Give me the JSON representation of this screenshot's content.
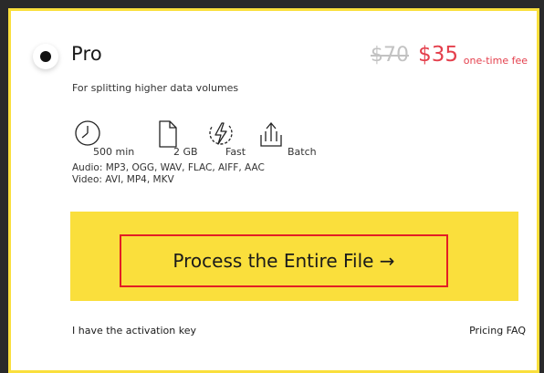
{
  "plan": {
    "name": "Pro",
    "old_price": "$70",
    "new_price": "$35",
    "fee_note": "one-time fee",
    "description": "For splitting higher data volumes"
  },
  "features": [
    {
      "icon": "clock-icon",
      "label": "500 min"
    },
    {
      "icon": "file-icon",
      "label": "2 GB"
    },
    {
      "icon": "lightning-icon",
      "label": "Fast"
    },
    {
      "icon": "batch-upload-icon",
      "label": "Batch"
    }
  ],
  "formats": {
    "audio": "Audio: MP3, OGG, WAV, FLAC, AIFF, AAC",
    "video": "Video: AVI, MP4, MKV"
  },
  "cta": {
    "label": "Process the Entire File →"
  },
  "footer": {
    "activation": "I have the activation key",
    "faq": "Pricing FAQ"
  },
  "colors": {
    "accent_yellow": "#fadf3c",
    "price_red": "#e43f4c",
    "highlight_border": "#e31e24"
  }
}
